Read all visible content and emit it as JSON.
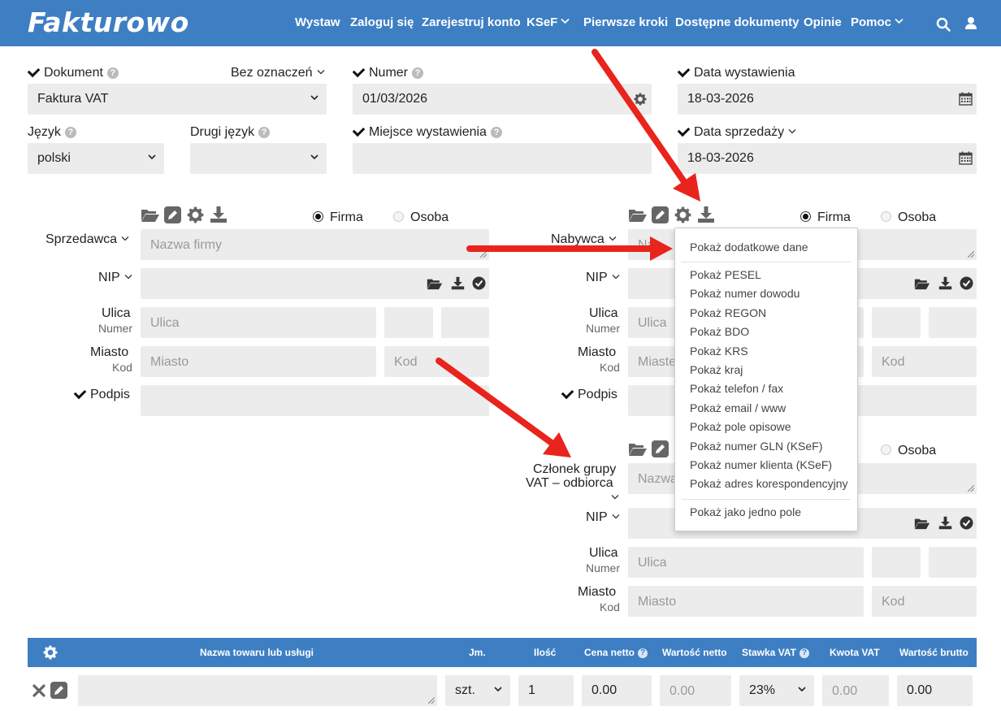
{
  "app": {
    "logo": "Fakturowo",
    "nav": [
      {
        "label": "Wystaw"
      },
      {
        "label": "Zaloguj się"
      },
      {
        "label": "Zarejestruj konto"
      },
      {
        "label": "KSeF"
      },
      {
        "label": "Pierwsze kroki"
      },
      {
        "label": "Dostępne dokumenty"
      },
      {
        "label": "Opinie"
      },
      {
        "label": "Pomoc"
      }
    ]
  },
  "doc": {
    "dokument_label": "Dokument",
    "bez_oznaczen": "Bez oznaczeń",
    "dokument_value": "Faktura VAT",
    "numer_label": "Numer",
    "numer_value": "01/03/2026",
    "data_wyst_label": "Data wystawienia",
    "data_wyst_value": "18-03-2026",
    "jezyk_label": "Język",
    "jezyk_value": "polski",
    "drugi_jezyk_label": "Drugi język",
    "miejsce_label": "Miejsce wystawienia",
    "data_sprz_label": "Data sprzedaży",
    "data_sprz_value": "18-03-2026"
  },
  "seller": {
    "role_label": "Sprzedawca",
    "firma": "Firma",
    "osoba": "Osoba",
    "name_ph": "Nazwa firmy",
    "nip_label": "NIP",
    "ulica_label": "Ulica",
    "numer_label": "Numer",
    "ulica_ph": "Ulica",
    "miasto_label": "Miasto",
    "kod_label": "Kod",
    "miasto_ph": "Miasto",
    "kod_ph": "Kod",
    "podpis_label": "Podpis"
  },
  "buyer": {
    "role_label": "Nabywca",
    "firma": "Firma",
    "osoba": "Osoba",
    "name_ph": "Naz",
    "nip_label": "NIP",
    "ulica_label": "Ulica",
    "numer_label": "Numer",
    "ulica_ph": "Ulica",
    "miasto_label": "Miasto",
    "kod_label": "Kod",
    "miasto_ph": "Miaste",
    "kod_ph": "Kod",
    "podpis_label": "Podpis"
  },
  "member": {
    "role_line1": "Członek grupy",
    "role_line2": "VAT – odbiorca",
    "osoba": "Osoba",
    "name_ph": "Nazwa",
    "nip_label": "NIP",
    "ulica_label": "Ulica",
    "numer_label": "Numer",
    "ulica_ph": "Ulica",
    "miasto_label": "Miasto",
    "kod_label": "Kod",
    "miasto_ph": "Miasto",
    "kod_ph": "Kod"
  },
  "menu": {
    "items": [
      "Pokaż dodatkowe dane",
      "Pokaż PESEL",
      "Pokaż numer dowodu",
      "Pokaż REGON",
      "Pokaż BDO",
      "Pokaż KRS",
      "Pokaż kraj",
      "Pokaż telefon / fax",
      "Pokaż email / www",
      "Pokaż pole opisowe",
      "Pokaż numer GLN (KSeF)",
      "Pokaż numer klienta (KSeF)",
      "Pokaż adres korespondencyjny",
      "Pokaż jako jedno pole"
    ]
  },
  "table": {
    "headers": [
      "Nazwa towaru lub usługi",
      "Jm.",
      "Ilość",
      "Cena netto",
      "Wartość netto",
      "Stawka VAT",
      "Kwota VAT",
      "Wartość brutto"
    ],
    "row": {
      "jm": "szt.",
      "ilosc": "1",
      "cena_netto": "0.00",
      "wartosc_netto": "0.00",
      "stawka_vat": "23%",
      "kwota_vat": "0.00",
      "wartosc_brutto": "0.00"
    }
  },
  "colors": {
    "brand": "#3e7fc4",
    "field_bg": "#ececec",
    "arrow": "#e8241c"
  }
}
